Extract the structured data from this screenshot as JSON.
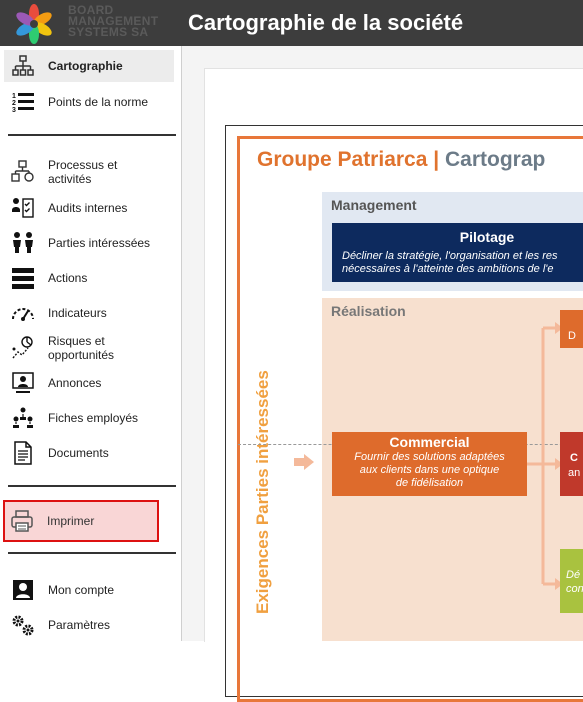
{
  "header": {
    "logo_text_lines": [
      "BOARD",
      "MANAGEMENT",
      "SYSTEMS SA"
    ],
    "page_title": "Cartographie de la société"
  },
  "sidebar": {
    "items": [
      {
        "label": "Cartographie",
        "icon": "org-chart-icon",
        "active": true
      },
      {
        "label": "Points de la norme",
        "icon": "numbered-list-icon"
      },
      {
        "label": "Processus et activités",
        "icon": "process-icon"
      },
      {
        "label": "Audits internes",
        "icon": "audit-icon"
      },
      {
        "label": "Parties intéressées",
        "icon": "people-icon"
      },
      {
        "label": "Actions",
        "icon": "actions-icon"
      },
      {
        "label": "Indicateurs",
        "icon": "gauge-icon"
      },
      {
        "label": "Risques et opportunités",
        "icon": "risk-icon"
      },
      {
        "label": "Annonces",
        "icon": "announcement-icon"
      },
      {
        "label": "Fiches employés",
        "icon": "employees-icon"
      },
      {
        "label": "Documents",
        "icon": "document-icon"
      }
    ],
    "print_label": "Imprimer",
    "bottom_items": [
      {
        "label": "Mon compte",
        "icon": "account-icon"
      },
      {
        "label": "Paramètres",
        "icon": "settings-icon"
      }
    ]
  },
  "map": {
    "title_part1": "Groupe Patriarca",
    "title_sep": "|",
    "title_part2": "Cartograp",
    "management_label": "Management",
    "pilotage_title": "Pilotage",
    "pilotage_desc_line1": "Décliner la stratégie, l'organisation et les res",
    "pilotage_desc_line2": "nécessaires à l'atteinte des ambitions de l'e",
    "realisation_label": "Réalisation",
    "vertical_label": "Exigences Parties intéressées",
    "commercial_title": "Commercial",
    "commercial_desc": [
      "Fournir des solutions adaptées",
      "aux clients  dans une optique",
      "de fidélisation"
    ],
    "box_orange_text": "D",
    "box_red_text": [
      "C",
      "an"
    ],
    "box_green_text": [
      "Dé",
      "con"
    ]
  },
  "colors": {
    "topbar": "#3d3d3d",
    "accent_orange": "#e0732e",
    "pilotage_navy": "#0d2a5e",
    "print_highlight_border": "#dd1111"
  }
}
